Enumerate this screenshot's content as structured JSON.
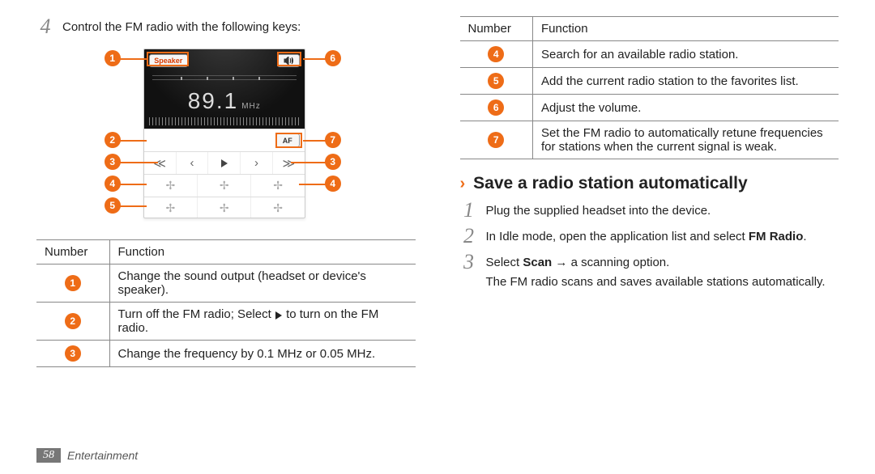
{
  "leftStep": {
    "num": "4",
    "text": "Control the FM radio with the following keys:"
  },
  "fm": {
    "speaker_label": "Speaker",
    "frequency": "89.1",
    "unit": "MHz",
    "af_label": "AF"
  },
  "callouts": [
    "1",
    "2",
    "3",
    "4",
    "5",
    "6",
    "7"
  ],
  "tableLeft": {
    "header_num": "Number",
    "header_func": "Function",
    "rows": [
      {
        "n": "1",
        "f": "Change the sound output (headset or device's speaker)."
      },
      {
        "n": "2",
        "f_pre": "Turn off the FM radio; Select ",
        "f_post": " to turn on the FM radio."
      },
      {
        "n": "3",
        "f": "Change the frequency by 0.1 MHz or 0.05 MHz."
      }
    ]
  },
  "tableRight": {
    "header_num": "Number",
    "header_func": "Function",
    "rows": [
      {
        "n": "4",
        "f": "Search for an available radio station."
      },
      {
        "n": "5",
        "f": "Add the current radio station to the favorites list."
      },
      {
        "n": "6",
        "f": "Adjust the volume."
      },
      {
        "n": "7",
        "f": "Set the FM radio to automatically retune frequencies for stations when the current signal is weak."
      }
    ]
  },
  "section": {
    "chevron": "›",
    "title": "Save a radio station automatically"
  },
  "steps": [
    {
      "num": "1",
      "body": "Plug the supplied headset into the device."
    },
    {
      "num": "2",
      "body_pre": "In Idle mode, open the application list and select ",
      "bold1": "FM Radio",
      "body_post": "."
    },
    {
      "num": "3",
      "body_pre": "Select ",
      "bold1": "Scan",
      "arrow": " → ",
      "body_post": "a scanning option.",
      "note": "The FM radio scans and saves available stations automatically."
    }
  ],
  "footer": {
    "page": "58",
    "section": "Entertainment"
  }
}
